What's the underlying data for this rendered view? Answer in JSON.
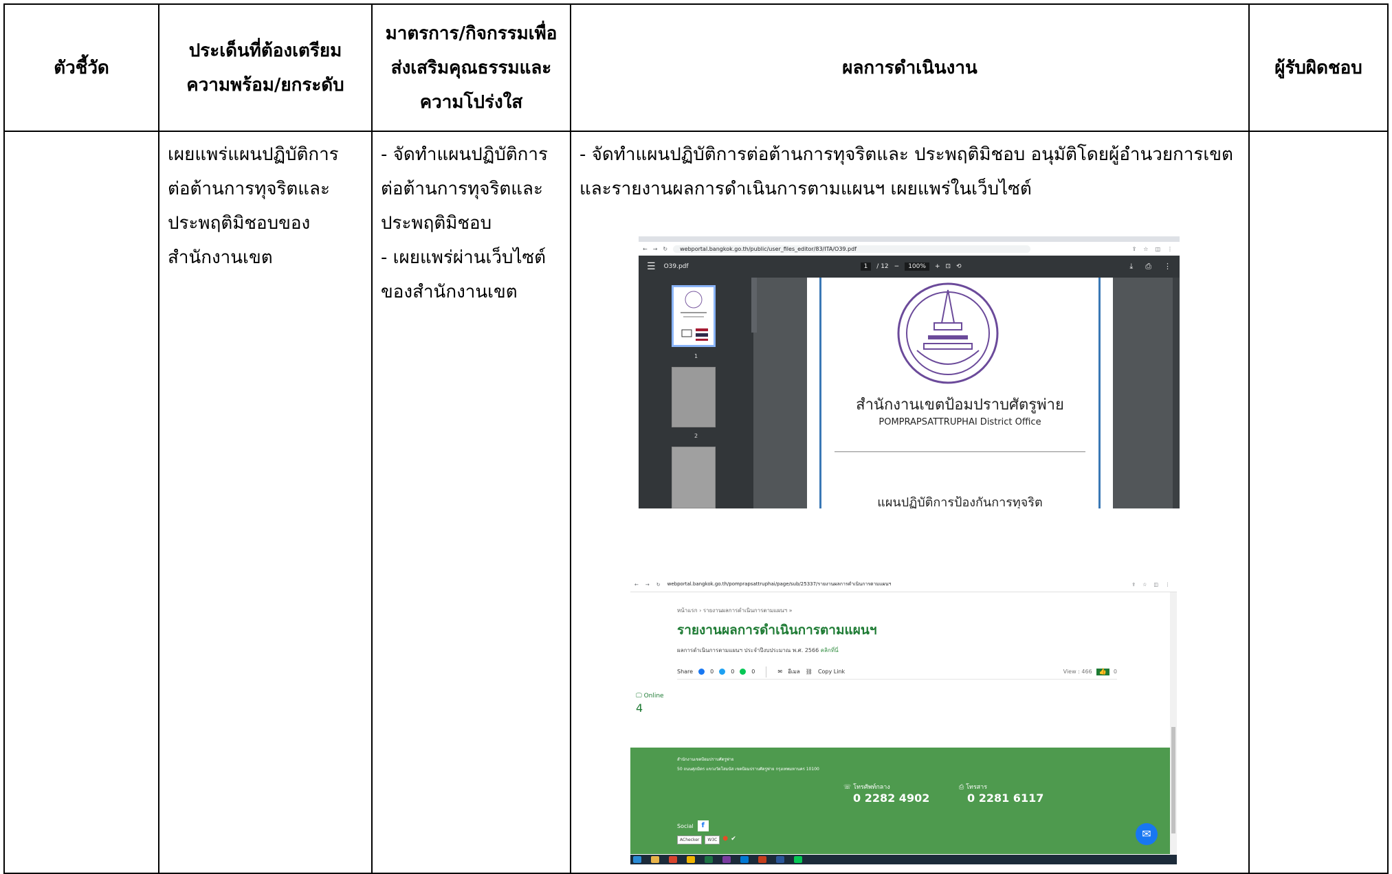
{
  "table": {
    "headers": {
      "indicator": "ตัวชี้วัด",
      "issue": [
        "ประเด็นที่ต้องเตรียม",
        "ความพร้อม/ยกระดับ"
      ],
      "measure": [
        "มาตรการ/กิจกรรมเพื่อ",
        "ส่งเสริมคุณธรรมและ",
        "ความโปร่งใส"
      ],
      "result": "ผลการดำเนินงาน",
      "responsible": "ผู้รับผิดชอบ"
    },
    "row": {
      "issue": [
        "เผยแพร่แผนปฏิบัติการ",
        "ต่อต้านการทุจริตและ",
        "ประพฤติมิชอบของ",
        "สำนักงานเขต"
      ],
      "measure": [
        "- จัดทำแผนปฏิบัติการ",
        "ต่อต้านการทุจริตและ",
        "ประพฤติมิชอบ",
        "- เผยแพร่ผ่านเว็บไซต์",
        "ของสำนักงานเขต"
      ],
      "result": [
        "- จัดทำแผนปฏิบัติการต่อต้านการทุจริตและ ประพฤติมิชอบ อนุมัติโดยผู้อำนวยการเขต",
        "และรายงานผลการดำเนินการตามแผนฯ เผยแพร่ในเว็บไซต์"
      ]
    }
  },
  "screenshot1": {
    "url": "webportal.bangkok.go.th/public/user_files_editor/83/ITA/O39.pdf",
    "file_name": "O39.pdf",
    "page_indicator": "1",
    "page_total": "/ 12",
    "zoom": "100%",
    "thumb_numbers": [
      "1",
      "2"
    ],
    "office_th": "สำนักงานเขตป้อมปราบศัตรูพ่าย",
    "office_en": "POMPRAPSATTRUPHAI  District Office",
    "plan_title": "แผนปฏิบัติการป้องกันการทุจริต"
  },
  "screenshot2": {
    "url": "webportal.bangkok.go.th/pomprapsattruphai/page/sub/25337/รายงานผลการดำเนินการตามแผนฯ",
    "breadcrumb": "หน้าแรก › รายงานผลการดำเนินการตามแผนฯ »",
    "title": "รายงานผลการดำเนินการตามแผนฯ",
    "description": "ผลการดำเนินการตามแผนฯ ประจำปีงบประมาณ พ.ศ. 2566",
    "link_text": "คลิกที่นี่",
    "share_label": "Share",
    "share_fb": "0",
    "share_tw": "0",
    "share_line": "0",
    "email_label": "อีเมล",
    "copy_link": "Copy Link",
    "view_label": "View : 466",
    "like_count": "0",
    "online_label": "Online",
    "online_count": "4",
    "footer_name": "สำนักงานเขตป้อมปราบศัตรูพ่าย",
    "footer_address": "50 ถนนศุภมิตร แขวงวัดโสมนัส เขตป้อมปราบศัตรูพ่าย กรุงเทพมหานคร 10100",
    "phone_label": "โทรศัพท์กลาง",
    "phone_number": "0 2282 4902",
    "fax_label": "โทรสาร",
    "fax_number": "0 2281 6117",
    "social_label": "Social",
    "badge_checker": "AChecker",
    "badge_w3c": "W3C"
  }
}
